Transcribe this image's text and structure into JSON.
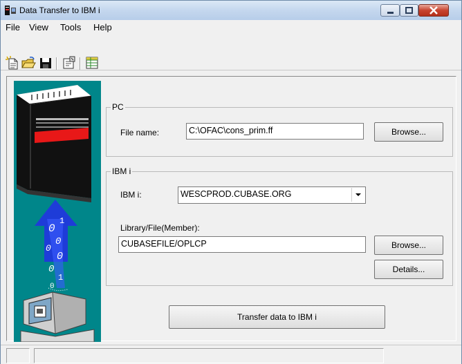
{
  "window": {
    "title": "Data Transfer to IBM i",
    "controls": [
      "minimize-icon",
      "maximize-icon",
      "close-icon"
    ]
  },
  "menu": {
    "items": [
      {
        "label": "File"
      },
      {
        "label": "View"
      },
      {
        "label": "Tools"
      },
      {
        "label": "Help"
      }
    ]
  },
  "toolbar": {
    "buttons": [
      {
        "icon": "new-request-icon"
      },
      {
        "icon": "open-folder-icon"
      },
      {
        "icon": "save-disk-icon"
      },
      {
        "icon": "properties-icon"
      },
      {
        "icon": "format-table-icon"
      }
    ]
  },
  "pc_group": {
    "legend": "PC",
    "file_name_label": "File name:",
    "file_name_value": "C:\\OFAC\\cons_prim.ff",
    "browse_label": "Browse..."
  },
  "ibm_group": {
    "legend": "IBM i",
    "system_label": "IBM i:",
    "system_value": "WESCPROD.CUBASE.ORG",
    "library_label": "Library/File(Member):",
    "library_value": "CUBASEFILE/OPLCP",
    "browse_label": "Browse...",
    "details_label": "Details..."
  },
  "transfer_button_label": "Transfer data to IBM i",
  "colors": {
    "illustration_bg": "#00868a",
    "arrow": "#1e3cd8",
    "server_band": "#e81818"
  }
}
